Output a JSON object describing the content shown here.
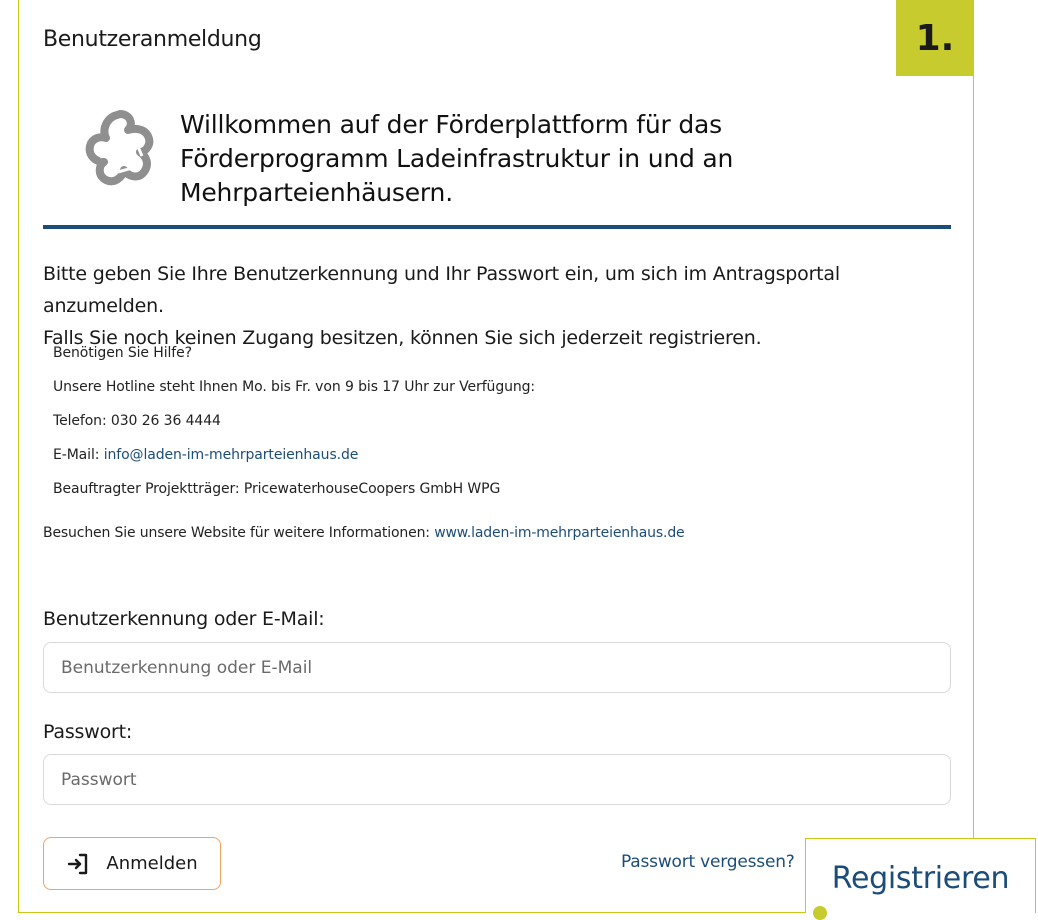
{
  "panel": {
    "title": "Benutzeranmeldung",
    "step_badge": "1."
  },
  "welcome": {
    "line1": "Willkommen auf der Förderplattform für das",
    "line2": "Förderprogramm Ladeinfrastruktur in und an",
    "line3": "Mehrparteienhäusern.",
    "logo_icon": "chain-star-icon"
  },
  "intro": {
    "line1": "Bitte geben Sie Ihre Benutzerkennung und Ihr Passwort ein, um sich im Antragsportal anzumelden.",
    "line2": "Falls Sie noch keinen Zugang besitzen, können Sie sich jederzeit registrieren."
  },
  "help": {
    "question": "Benötigen Sie Hilfe?",
    "hotline": "Unsere Hotline steht Ihnen Mo. bis Fr. von 9 bis 17 Uhr zur Verfügung:",
    "phone": "Telefon: 030 26 36 4444",
    "email_prefix": "E-Mail: ",
    "email": "info@laden-im-mehrparteienhaus.de",
    "sponsor": "Beauftragter Projektträger: PricewaterhouseCoopers GmbH WPG"
  },
  "website": {
    "prefix": "Besuchen Sie unsere Website für weitere Informationen: ",
    "link": "www.laden-im-mehrparteienhaus.de"
  },
  "form": {
    "username_label": "Benutzerkennung oder E-Mail:",
    "username_placeholder": "Benutzerkennung oder E-Mail",
    "username_value": "",
    "password_label": "Passwort:",
    "password_placeholder": "Passwort",
    "password_value": "",
    "login_button": "Anmelden",
    "login_icon": "sign-in-icon",
    "forgot_link": "Passwort vergessen?"
  },
  "register_tab": {
    "label": "Registrieren"
  },
  "colors": {
    "accent_lime": "#c8cb2d",
    "brand_blue": "#1c4d78",
    "button_border_orange": "#f0a35e"
  }
}
